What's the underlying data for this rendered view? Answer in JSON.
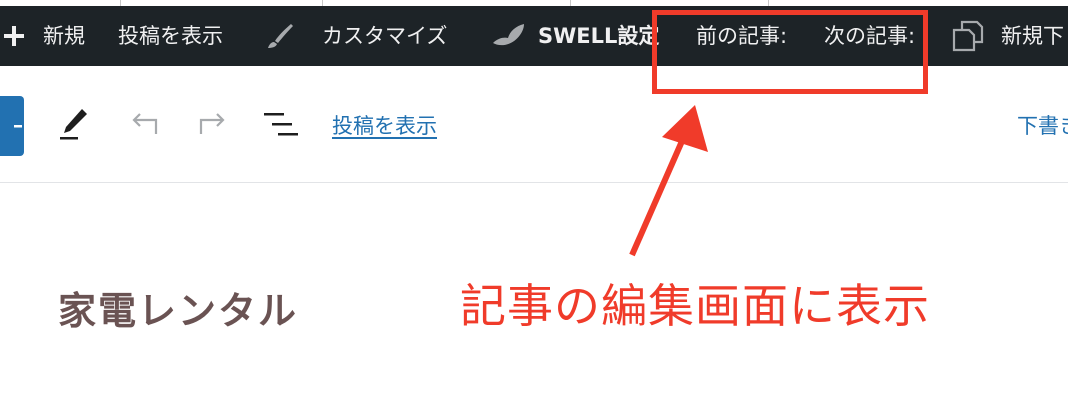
{
  "admin_bar": {
    "new_label": "新規",
    "view_post_label": "投稿を表示",
    "customize_label": "カスタマイズ",
    "swell_label": "SWELL設定",
    "prev_post_label": "前の記事:",
    "next_post_label": "次の記事:",
    "new_draft_label": "新規下"
  },
  "toolbar": {
    "view_post_link": "投稿を表示",
    "draft_label": "下書き"
  },
  "post": {
    "title": "家電レンタル"
  },
  "annotation": {
    "text": "記事の編集画面に表示",
    "color": "#f03b2a"
  },
  "colors": {
    "admin_bar_bg": "#1d2327",
    "accent": "#2271b1",
    "title_color": "#6a5353"
  }
}
